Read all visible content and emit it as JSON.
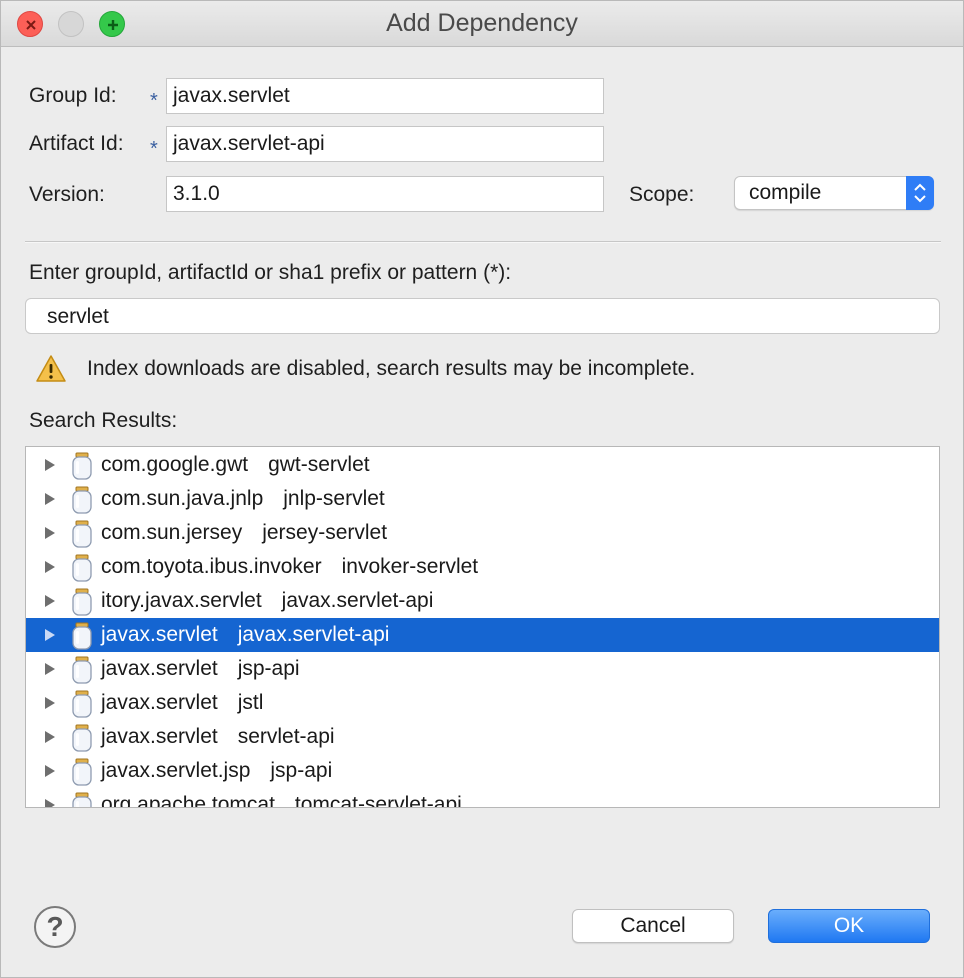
{
  "window": {
    "title": "Add Dependency"
  },
  "form": {
    "group_id_label": "Group Id:",
    "group_id_value": "javax.servlet",
    "artifact_id_label": "Artifact Id:",
    "artifact_id_value": "javax.servlet-api",
    "required_marker": "*",
    "version_label": "Version:",
    "version_value": "3.1.0",
    "scope_label": "Scope:",
    "scope_value": "compile"
  },
  "search": {
    "prompt": "Enter groupId, artifactId or sha1 prefix or pattern (*):",
    "value": "servlet",
    "warning": "Index downloads are disabled, search results may be incomplete.",
    "results_label": "Search Results:"
  },
  "results": [
    {
      "group": "com.google.gwt",
      "artifact": "gwt-servlet",
      "selected": false
    },
    {
      "group": "com.sun.java.jnlp",
      "artifact": "jnlp-servlet",
      "selected": false
    },
    {
      "group": "com.sun.jersey",
      "artifact": "jersey-servlet",
      "selected": false
    },
    {
      "group": "com.toyota.ibus.invoker",
      "artifact": "invoker-servlet",
      "selected": false
    },
    {
      "group": "itory.javax.servlet",
      "artifact": "javax.servlet-api",
      "selected": false
    },
    {
      "group": "javax.servlet",
      "artifact": "javax.servlet-api",
      "selected": true
    },
    {
      "group": "javax.servlet",
      "artifact": "jsp-api",
      "selected": false
    },
    {
      "group": "javax.servlet",
      "artifact": "jstl",
      "selected": false
    },
    {
      "group": "javax.servlet",
      "artifact": "servlet-api",
      "selected": false
    },
    {
      "group": "javax.servlet.jsp",
      "artifact": "jsp-api",
      "selected": false
    },
    {
      "group": "org.apache.tomcat",
      "artifact": "tomcat-servlet-api",
      "selected": false
    }
  ],
  "buttons": {
    "help": "?",
    "cancel": "Cancel",
    "ok": "OK"
  },
  "colors": {
    "selection": "#1565d1",
    "accent": "#2f7df6",
    "warning": "#f4c04a"
  }
}
